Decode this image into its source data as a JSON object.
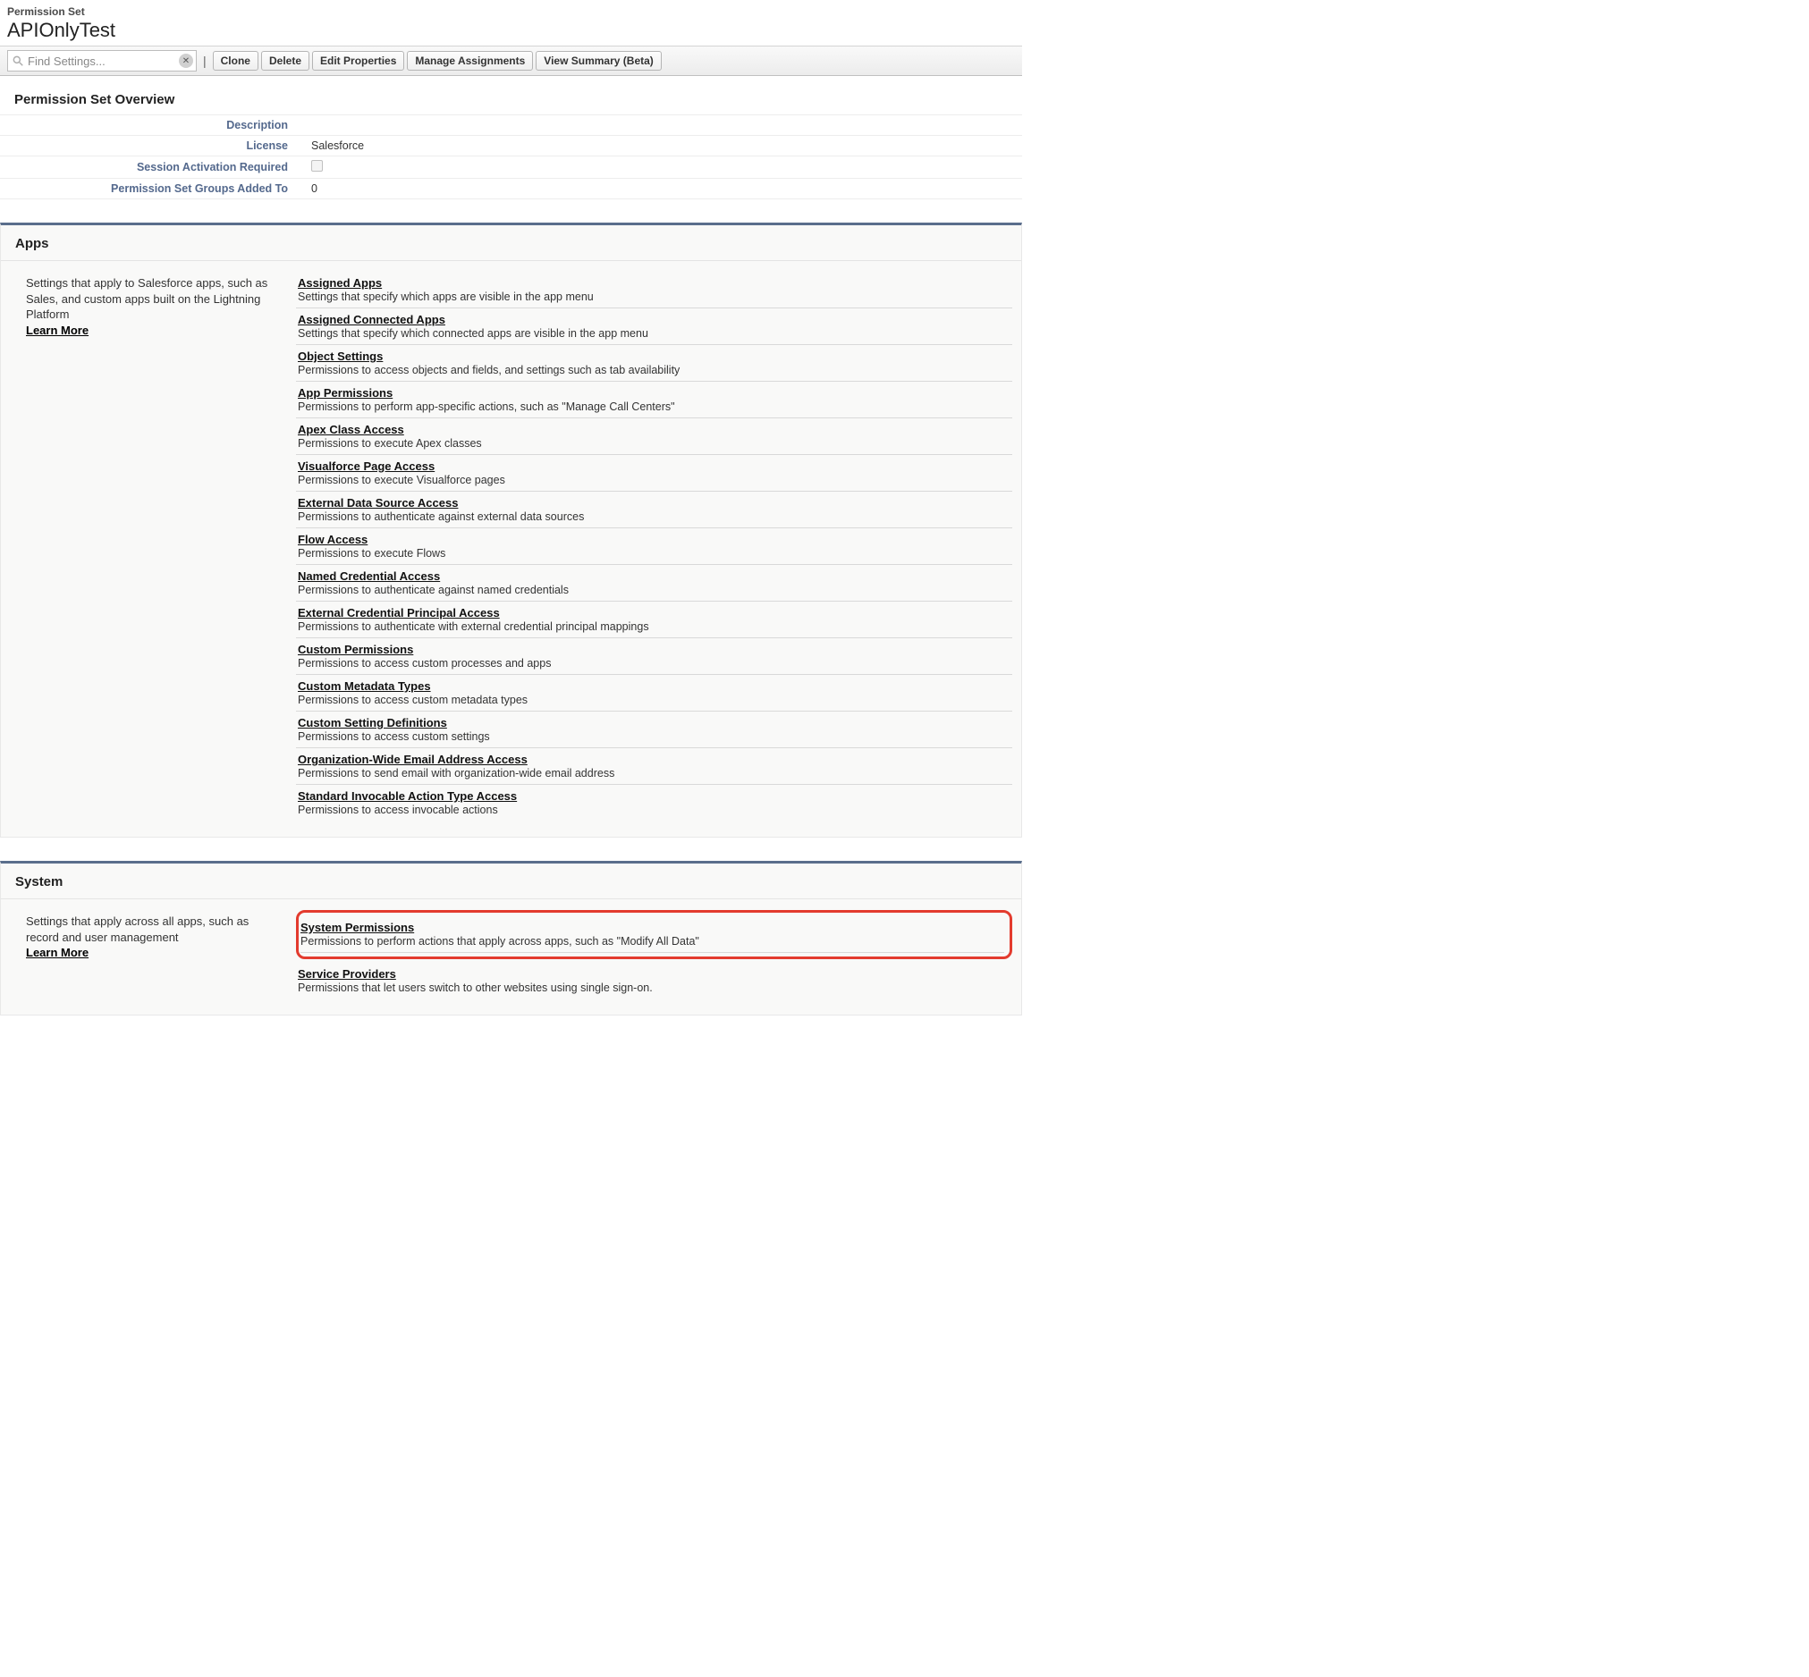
{
  "header": {
    "pretitle": "Permission Set",
    "title": "APIOnlyTest"
  },
  "toolbar": {
    "search_placeholder": "Find Settings...",
    "buttons": {
      "clone": "Clone",
      "delete": "Delete",
      "edit_properties": "Edit Properties",
      "manage_assignments": "Manage Assignments",
      "view_summary": "View Summary (Beta)"
    }
  },
  "overview": {
    "heading": "Permission Set Overview",
    "rows": {
      "description_label": "Description",
      "description_value": "",
      "license_label": "License",
      "license_value": "Salesforce",
      "session_label": "Session Activation Required",
      "groups_label": "Permission Set Groups Added To",
      "groups_value": "0"
    }
  },
  "apps": {
    "heading": "Apps",
    "intro": "Settings that apply to Salesforce apps, such as Sales, and custom apps built on the Lightning Platform",
    "learn_more": "Learn More",
    "items": [
      {
        "title": "Assigned Apps",
        "desc": "Settings that specify which apps are visible in the app menu"
      },
      {
        "title": "Assigned Connected Apps",
        "desc": "Settings that specify which connected apps are visible in the app menu"
      },
      {
        "title": "Object Settings",
        "desc": "Permissions to access objects and fields, and settings such as tab availability"
      },
      {
        "title": "App Permissions",
        "desc": "Permissions to perform app-specific actions, such as \"Manage Call Centers\""
      },
      {
        "title": "Apex Class Access",
        "desc": "Permissions to execute Apex classes"
      },
      {
        "title": "Visualforce Page Access",
        "desc": "Permissions to execute Visualforce pages"
      },
      {
        "title": "External Data Source Access",
        "desc": "Permissions to authenticate against external data sources"
      },
      {
        "title": "Flow Access",
        "desc": "Permissions to execute Flows"
      },
      {
        "title": "Named Credential Access",
        "desc": "Permissions to authenticate against named credentials"
      },
      {
        "title": "External Credential Principal Access",
        "desc": "Permissions to authenticate with external credential principal mappings"
      },
      {
        "title": "Custom Permissions",
        "desc": "Permissions to access custom processes and apps"
      },
      {
        "title": "Custom Metadata Types",
        "desc": "Permissions to access custom metadata types"
      },
      {
        "title": "Custom Setting Definitions",
        "desc": "Permissions to access custom settings"
      },
      {
        "title": "Organization-Wide Email Address Access",
        "desc": "Permissions to send email with organization-wide email address"
      },
      {
        "title": "Standard Invocable Action Type Access",
        "desc": "Permissions to access invocable actions"
      }
    ]
  },
  "system": {
    "heading": "System",
    "intro": "Settings that apply across all apps, such as record and user management",
    "learn_more": "Learn More",
    "items": [
      {
        "title": "System Permissions",
        "desc": "Permissions to perform actions that apply across apps, such as \"Modify All Data\"",
        "highlight": true
      },
      {
        "title": "Service Providers",
        "desc": "Permissions that let users switch to other websites using single sign-on."
      }
    ]
  }
}
